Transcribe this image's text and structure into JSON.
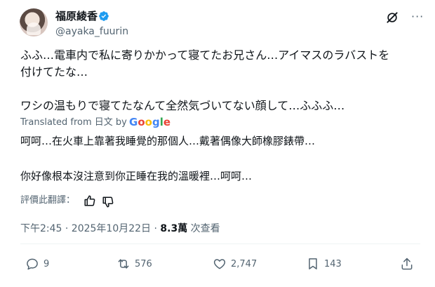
{
  "author": {
    "display_name": "福原綾香",
    "handle": "@ayaka_fuurin"
  },
  "icons": {
    "verified": "verified-badge-icon",
    "grok": "grok-icon",
    "more": "more-options-icon",
    "reply": "reply-icon",
    "repost": "repost-icon",
    "like": "like-icon",
    "bookmark": "bookmark-icon",
    "share": "share-icon",
    "thumb_up": "thumbs-up-icon",
    "thumb_down": "thumbs-down-icon"
  },
  "colors": {
    "text": "#0f1419",
    "secondary": "#536471",
    "verified": "#1d9bf0"
  },
  "tweet": {
    "lines": [
      "ふふ…電車内で私に寄りかかって寝てたお兄さん…アイマスのラバストを",
      "付けてたな…",
      "ワシの温もりで寝てたなんて全然気づいてない顔して…ふふふ…"
    ],
    "translation_label": "Translated from 日文 by",
    "translation_provider": "Google",
    "translated_lines": [
      "呵呵…在火車上靠著我睡覺的那個人…戴著偶像大師橡膠錶帶…",
      "你好像根本沒注意到你正睡在我的溫暖裡…呵呵…"
    ],
    "rate_translation_label": "評價此翻譯：",
    "time_date": "下午2:45 · 2025年10月22日 ·",
    "views_count": "8.3萬",
    "views_label": "次查看"
  },
  "actions": {
    "reply_count": "9",
    "repost_count": "576",
    "like_count": "2,747",
    "bookmark_count": "143"
  }
}
